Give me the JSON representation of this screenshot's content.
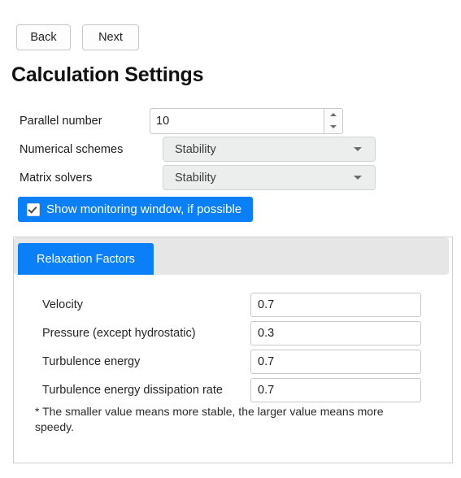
{
  "window": {
    "title": "Calculation Settings"
  },
  "nav": {
    "back_label": "Back",
    "next_label": "Next"
  },
  "settings": {
    "parallel_number": {
      "label": "Parallel number",
      "value": "10"
    },
    "numerical_schemes": {
      "label": "Numerical schemes",
      "value": "Stability"
    },
    "matrix_solvers": {
      "label": "Matrix solvers",
      "value": "Stability"
    },
    "monitoring": {
      "label": "Show monitoring window, if possible",
      "checked": true
    }
  },
  "panel": {
    "tabs": [
      {
        "label": "Relaxation Factors",
        "active": true
      }
    ],
    "rows": [
      {
        "label": "Velocity",
        "value": "0.7"
      },
      {
        "label": "Pressure (except hydrostatic)",
        "value": "0.3"
      },
      {
        "label": "Turbulence energy",
        "value": "0.7"
      },
      {
        "label": "Turbulence energy dissipation rate",
        "value": "0.7"
      }
    ],
    "footnote": "* The smaller value means more stable, the larger value means more speedy."
  },
  "colors": {
    "accent_blue": "#0b7ff7",
    "tab_strip_gray": "#e6e6e6",
    "combo_gray": "#eceded"
  }
}
